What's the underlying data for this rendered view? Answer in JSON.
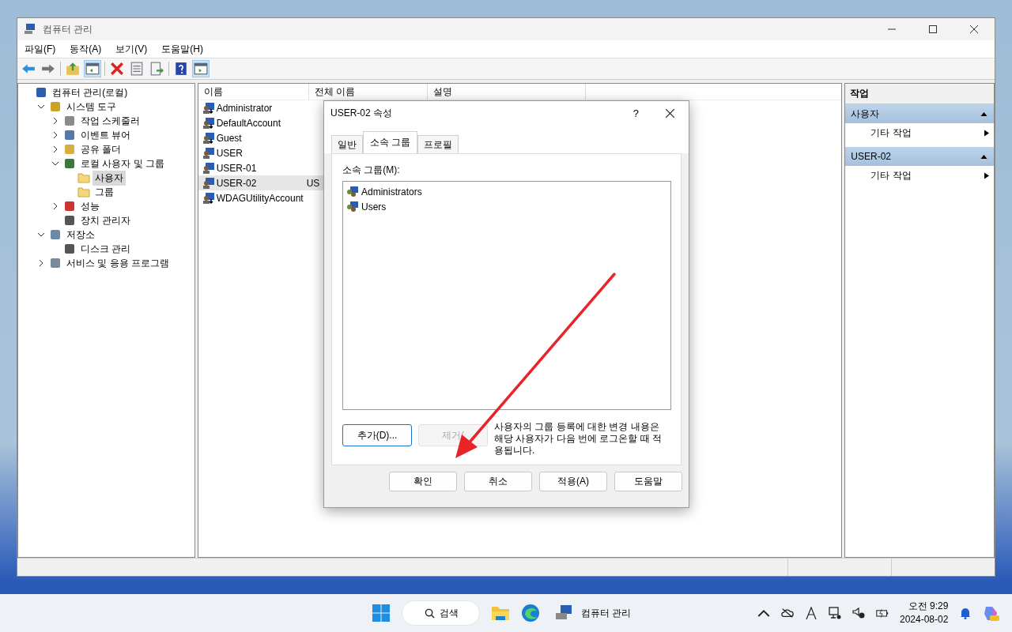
{
  "window": {
    "title": "컴퓨터 관리"
  },
  "menu": [
    "파일(F)",
    "동작(A)",
    "보기(V)",
    "도움말(H)"
  ],
  "tree": [
    {
      "label": "컴퓨터 관리(로컬)",
      "kind": "computer",
      "selected": false,
      "children": [
        {
          "label": "시스템 도구",
          "kind": "tool",
          "selected": false,
          "expanded": true,
          "children": [
            {
              "label": "작업 스케줄러",
              "kind": "clock",
              "selected": false,
              "expanded": false
            },
            {
              "label": "이벤트 뷰어",
              "kind": "log",
              "selected": false,
              "expanded": false
            },
            {
              "label": "공유 폴더",
              "kind": "share",
              "selected": false,
              "expanded": false
            },
            {
              "label": "로컬 사용자 및 그룹",
              "kind": "users",
              "selected": false,
              "expanded": true,
              "children": [
                {
                  "label": "사용자",
                  "kind": "folder",
                  "selected": true
                },
                {
                  "label": "그룹",
                  "kind": "folder",
                  "selected": false
                }
              ]
            },
            {
              "label": "성능",
              "kind": "gauge",
              "selected": false,
              "expanded": false
            },
            {
              "label": "장치 관리자",
              "kind": "device",
              "selected": false
            }
          ]
        },
        {
          "label": "저장소",
          "kind": "storage",
          "selected": false,
          "expanded": true,
          "children": [
            {
              "label": "디스크 관리",
              "kind": "device",
              "selected": false
            }
          ]
        },
        {
          "label": "서비스 및 응용 프로그램",
          "kind": "service",
          "selected": false,
          "expanded": false
        }
      ]
    }
  ],
  "list": {
    "columns": [
      "이름",
      "전체 이름",
      "설명"
    ],
    "rows": [
      {
        "name": "Administrator",
        "full_name": "",
        "disabled": true,
        "selected": false
      },
      {
        "name": "DefaultAccount",
        "full_name": "",
        "disabled": true,
        "selected": false
      },
      {
        "name": "Guest",
        "full_name": "",
        "disabled": true,
        "selected": false
      },
      {
        "name": "USER",
        "full_name": "",
        "disabled": false,
        "selected": false
      },
      {
        "name": "USER-01",
        "full_name": "",
        "disabled": false,
        "selected": false
      },
      {
        "name": "USER-02",
        "full_name": "US",
        "disabled": false,
        "selected": true
      },
      {
        "name": "WDAGUtilityAccount",
        "full_name": "",
        "disabled": true,
        "selected": false
      }
    ]
  },
  "actions": {
    "title": "작업",
    "sections": [
      {
        "title": "사용자",
        "items": [
          "기타 작업"
        ]
      },
      {
        "title": "USER-02",
        "items": [
          "기타 작업"
        ]
      }
    ]
  },
  "dialog": {
    "title": "USER-02 속성",
    "help": "?",
    "tabs": [
      {
        "label": "일반",
        "selected": false
      },
      {
        "label": "소속 그룹",
        "selected": true
      },
      {
        "label": "프로필",
        "selected": false
      }
    ],
    "groups_label": "소속 그룹(M):",
    "groups": [
      "Administrators",
      "Users"
    ],
    "buttons": [
      {
        "label": "추가(D)...",
        "disabled": false
      },
      {
        "label": "제거(",
        "disabled": true
      }
    ],
    "note": "사용자의 그룹 등록에 대한 변경 내용은 해당 사용자가 다음 번에 로그온할 때 적용됩니다.",
    "footer": [
      "확인",
      "취소",
      "적용(A)",
      "도움말"
    ]
  },
  "taskbar": {
    "search": "검색",
    "app": "컴퓨터 관리",
    "time": "오전 9:29",
    "date": "2024-08-02"
  }
}
